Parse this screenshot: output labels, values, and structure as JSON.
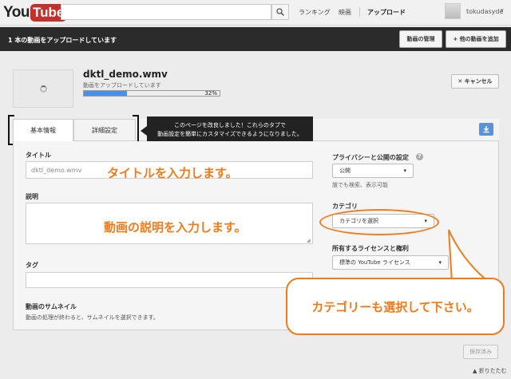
{
  "header": {
    "logo_you": "You",
    "logo_tube": "Tube",
    "nav": [
      "ランキング",
      "映画",
      "アップロード"
    ],
    "username": "tokudasyde",
    "caret": "▾"
  },
  "status_bar": {
    "text": "1 本の動画をアップロードしています",
    "manage_label": "動画の管理",
    "add_label": "+ 他の動画を追加"
  },
  "upload": {
    "file_name": "dktl_demo.wmv",
    "status": "動画をアップロードしています",
    "progress_percent": 32,
    "progress_label": "32%",
    "cancel_label": "✕ キャンセル"
  },
  "tabs": {
    "basic": "基本情報",
    "advanced": "詳細設定"
  },
  "tooltip": {
    "line1": "このページを改良しました！これらのタブで",
    "line2": "動画設定を簡単にカスタマイズできるようになりました。"
  },
  "form": {
    "title_label": "タイトル",
    "title_value": "dktl_demo.wmv",
    "description_label": "説明",
    "tags_label": "タグ",
    "thumbnail_label": "動画のサムネイル",
    "thumbnail_hint": "動画の処理が終わると、サムネイルを選択できます。",
    "privacy_label": "プライバシーと公開の設定",
    "privacy_value": "公開",
    "privacy_hint": "誰でも検索、表示可能",
    "category_label": "カテゴリ",
    "category_value": "カテゴリを選択",
    "license_label": "所有するライセンスと権利",
    "license_value": "標準の YouTube ライセンス",
    "save_label": "保存済み",
    "collapse_label": "▲ 折りたたむ"
  },
  "annotations": {
    "title_note": "タイトルを入力します。",
    "description_note": "動画の説明を入力します。",
    "category_note": "カテゴリーも選択して下さい。"
  },
  "colors": {
    "brand_red": "#c4302b",
    "accent_orange": "#f07b1b",
    "progress_blue": "#4a90e8"
  }
}
